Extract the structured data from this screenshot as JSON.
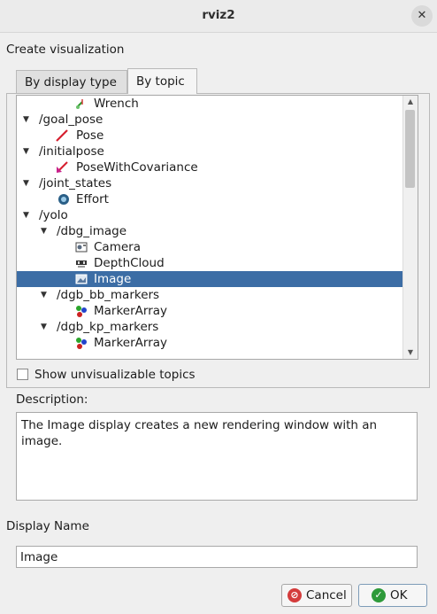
{
  "window": {
    "title": "rviz2",
    "close_glyph": "✕"
  },
  "section_title": "Create visualization",
  "tabs": [
    {
      "label": "By display type"
    },
    {
      "label": "By topic"
    }
  ],
  "tree": {
    "rows": [
      {
        "label": "Wrench",
        "icon": "wrench-icon"
      },
      {
        "label": "/goal_pose"
      },
      {
        "label": "Pose",
        "icon": "pose-arrow-icon"
      },
      {
        "label": "/initialpose"
      },
      {
        "label": "PoseWithCovariance",
        "icon": "pose-covariance-icon"
      },
      {
        "label": "/joint_states"
      },
      {
        "label": "Effort",
        "icon": "effort-icon"
      },
      {
        "label": "/yolo"
      },
      {
        "label": "/dbg_image"
      },
      {
        "label": "Camera",
        "icon": "camera-icon"
      },
      {
        "label": "DepthCloud",
        "icon": "depthcloud-icon"
      },
      {
        "label": "Image",
        "icon": "image-icon",
        "selected": true
      },
      {
        "label": "/dgb_bb_markers"
      },
      {
        "label": "MarkerArray",
        "icon": "marker-array-icon"
      },
      {
        "label": "/dgb_kp_markers"
      },
      {
        "label": "MarkerArray",
        "icon": "marker-array-icon"
      }
    ]
  },
  "show_unvisualizable": {
    "label": "Show unvisualizable topics",
    "checked": false
  },
  "description": {
    "label": "Description:",
    "text": "The Image display creates a new rendering window with an image."
  },
  "display_name": {
    "label": "Display Name",
    "value": "Image"
  },
  "buttons": {
    "cancel": "Cancel",
    "ok": "OK"
  },
  "colors": {
    "selection": "#3c6da5",
    "ok_icon": "#2e9a3a",
    "cancel_icon": "#d43c3c"
  }
}
